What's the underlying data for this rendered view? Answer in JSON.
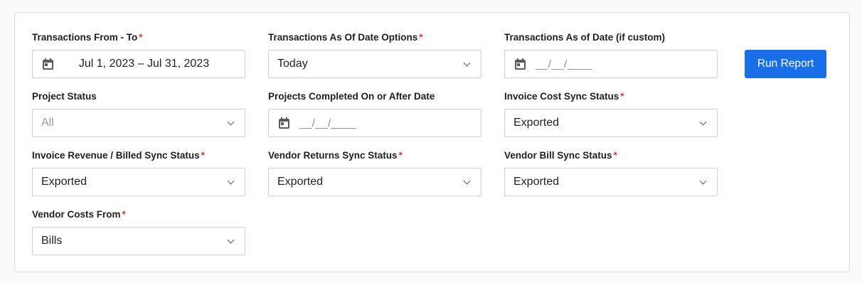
{
  "colors": {
    "accent": "#1a6fe8",
    "required": "#e03a2e",
    "border": "#d0d0d0"
  },
  "required_marker": "*",
  "fields": {
    "transactions_range": {
      "label": "Transactions From - To",
      "required": true,
      "value": "Jul 1, 2023 – Jul 31, 2023",
      "icon": "calendar-icon"
    },
    "as_of_options": {
      "label": "Transactions As Of Date Options",
      "required": true,
      "value": "Today"
    },
    "as_of_date": {
      "label": "Transactions As of Date (if custom)",
      "required": false,
      "placeholder": "__/__/____",
      "icon": "calendar-icon"
    },
    "project_status": {
      "label": "Project Status",
      "required": false,
      "value": "All"
    },
    "completed_after": {
      "label": "Projects Completed On or After Date",
      "required": false,
      "placeholder": "__/__/____",
      "icon": "calendar-icon"
    },
    "invoice_cost_sync": {
      "label": "Invoice Cost Sync Status",
      "required": true,
      "value": "Exported"
    },
    "invoice_revenue_sync": {
      "label": "Invoice Revenue / Billed Sync Status",
      "required": true,
      "value": "Exported"
    },
    "vendor_returns_sync": {
      "label": "Vendor Returns Sync Status",
      "required": true,
      "value": "Exported"
    },
    "vendor_bill_sync": {
      "label": "Vendor Bill Sync Status",
      "required": true,
      "value": "Exported"
    },
    "vendor_costs_from": {
      "label": "Vendor Costs From",
      "required": true,
      "value": "Bills"
    }
  },
  "run_report_button": {
    "label": "Run Report"
  }
}
